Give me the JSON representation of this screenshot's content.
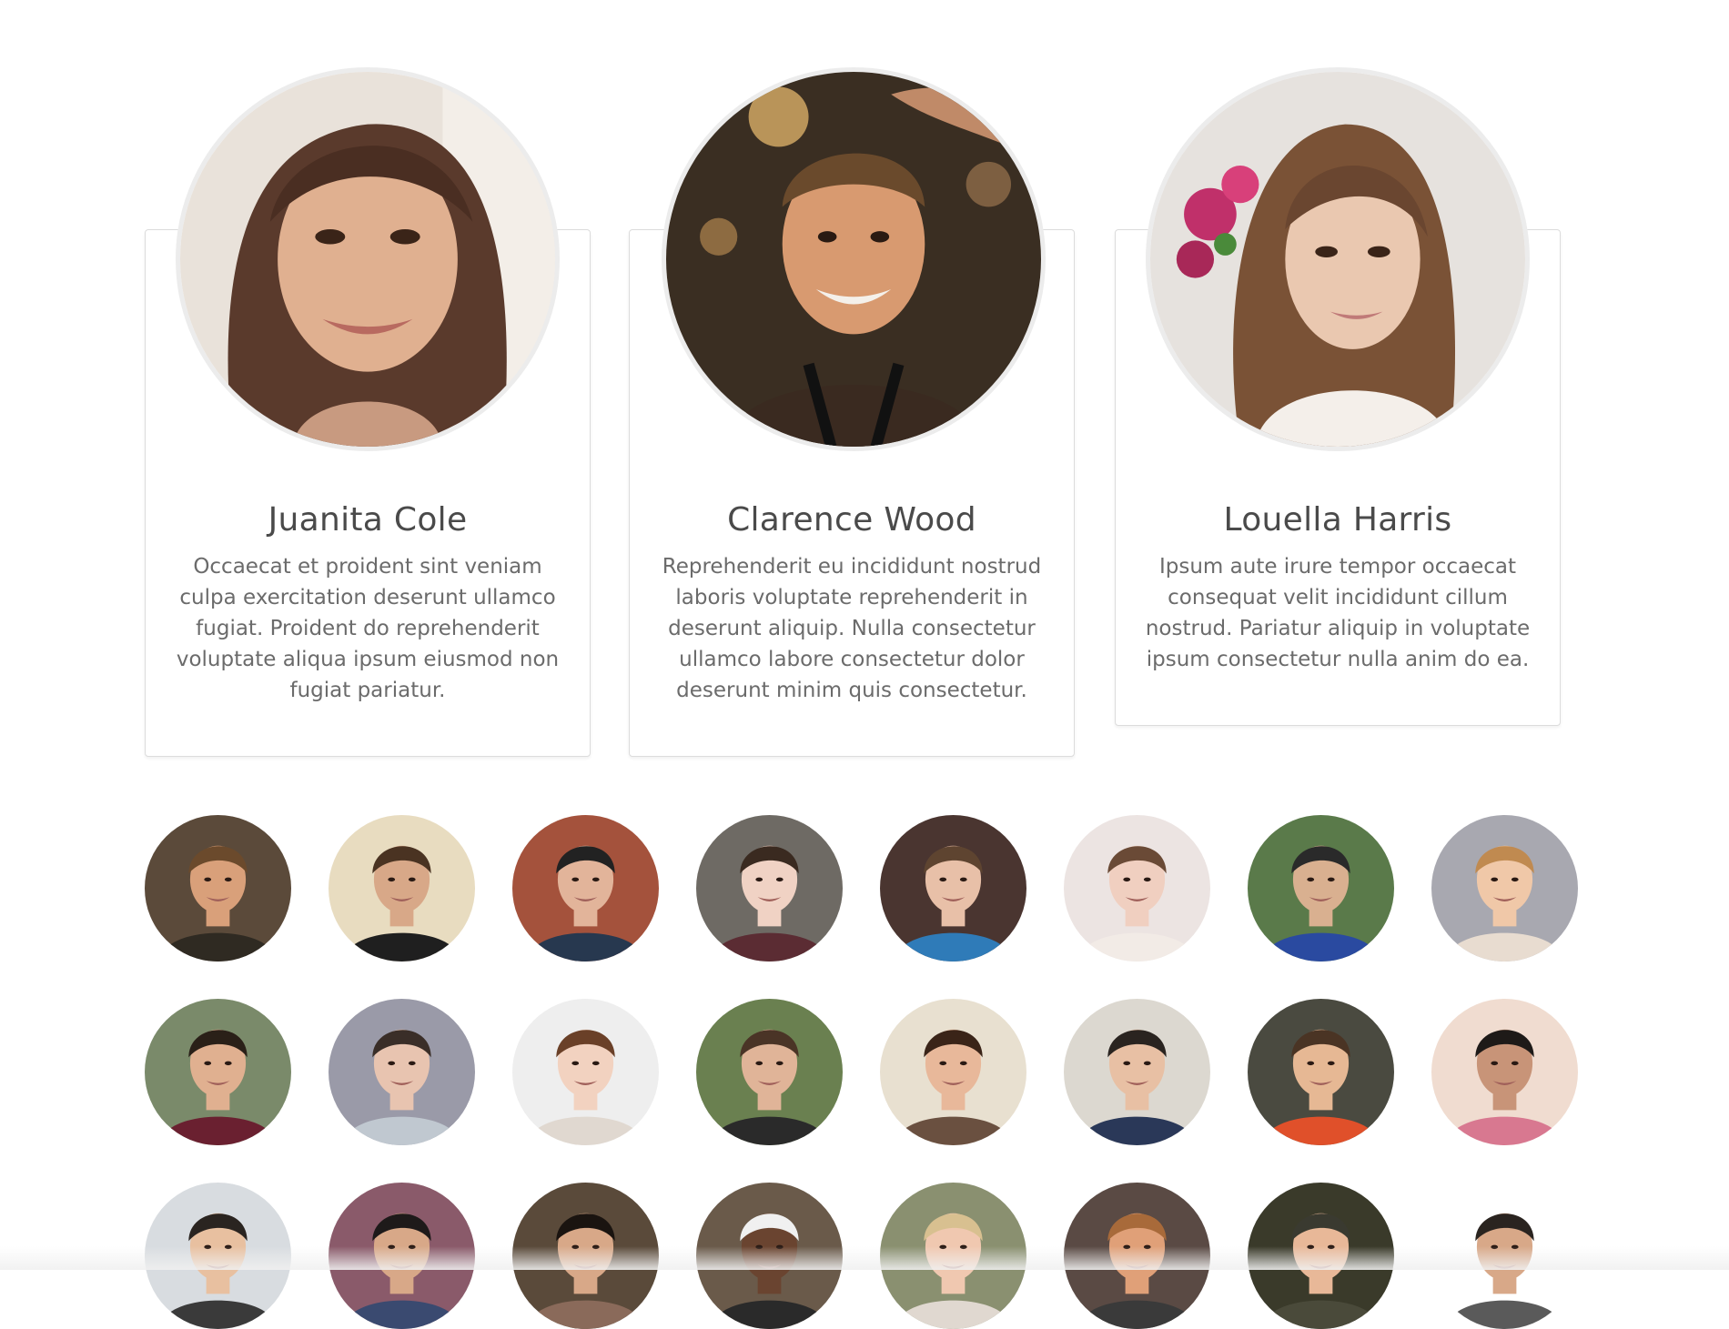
{
  "profiles": [
    {
      "name": "Juanita Cole",
      "description": "Occaecat et proident sint veniam culpa exercitation deserunt ullamco fugiat. Proident do reprehenderit voluptate aliqua ipsum eiusmod non fugiat pariatur.",
      "photo_icon": "woman-portrait-photo-icon"
    },
    {
      "name": "Clarence Wood",
      "description": "Reprehenderit eu incididunt nostrud laboris voluptate reprehenderit in deserunt aliquip. Nulla consectetur ullamco labore consectetur dolor deserunt minim quis consectetur.",
      "photo_icon": "man-portrait-photo-icon"
    },
    {
      "name": "Louella Harris",
      "description": "Ipsum aute irure tempor occaecat consequat velit incididunt cillum nostrud. Pariatur aliquip in voluptate ipsum consectetur nulla anim do ea.",
      "photo_icon": "woman-portrait-photo-icon"
    }
  ],
  "avatar_grid": {
    "columns": 8,
    "visible_rows": 3,
    "avatars": [
      {
        "bg": "#5b4a3a",
        "skin": "#d9a07a",
        "hair": "#6b4a2c",
        "shirt": "#2f2a22"
      },
      {
        "bg": "#e8dcc0",
        "skin": "#d8a888",
        "hair": "#4a3322",
        "shirt": "#1f1f1f"
      },
      {
        "bg": "#a4523c",
        "skin": "#e2b49a",
        "hair": "#222222",
        "shirt": "#27384f"
      },
      {
        "bg": "#6e6a64",
        "skin": "#f0d2c4",
        "hair": "#3a2a20",
        "shirt": "#5b2c33"
      },
      {
        "bg": "#4a3530",
        "skin": "#e8c0a8",
        "hair": "#5e4430",
        "shirt": "#2f7bb8"
      },
      {
        "bg": "#ece4e2",
        "skin": "#f0cfc0",
        "hair": "#6a4a36",
        "shirt": "#f2ebe6"
      },
      {
        "bg": "#5a7a4a",
        "skin": "#d9b090",
        "hair": "#2a2a2a",
        "shirt": "#2a4aa0"
      },
      {
        "bg": "#a8a8b0",
        "skin": "#f0c8a8",
        "hair": "#c08a50",
        "shirt": "#e8dcd0"
      },
      {
        "bg": "#7a8a6a",
        "skin": "#e0b090",
        "hair": "#2a2018",
        "shirt": "#6a2030"
      },
      {
        "bg": "#9a9aa8",
        "skin": "#e8c4b0",
        "hair": "#3a2e28",
        "shirt": "#c0c8d0"
      },
      {
        "bg": "#eeeeee",
        "skin": "#f2d2c0",
        "hair": "#6a4028",
        "shirt": "#e0d8d0"
      },
      {
        "bg": "#6a8050",
        "skin": "#e0b498",
        "hair": "#4a3426",
        "shirt": "#2a2a2a"
      },
      {
        "bg": "#e8e0d0",
        "skin": "#e8b89a",
        "hair": "#3a2418",
        "shirt": "#6a5040"
      },
      {
        "bg": "#dcd8d0",
        "skin": "#e8c0a4",
        "hair": "#2a2420",
        "shirt": "#2a3858"
      },
      {
        "bg": "#4a4a40",
        "skin": "#e6b894",
        "hair": "#4a3424",
        "shirt": "#e0502a"
      },
      {
        "bg": "#f0dcd0",
        "skin": "#c89478",
        "hair": "#1e1a18",
        "shirt": "#d87890"
      },
      {
        "bg": "#d8dce0",
        "skin": "#e8c0a0",
        "hair": "#2a2420",
        "shirt": "#3a3a3a"
      },
      {
        "bg": "#8a5a6a",
        "skin": "#d8a888",
        "hair": "#1e1a1a",
        "shirt": "#3a4a70"
      },
      {
        "bg": "#5a4a3a",
        "skin": "#d8a888",
        "hair": "#1a1410",
        "shirt": "#8a6a5a"
      },
      {
        "bg": "#6a5a4a",
        "skin": "#6a4430",
        "hair": "#f0f0f0",
        "shirt": "#2a2a2a"
      },
      {
        "bg": "#8a9070",
        "skin": "#f0c8b0",
        "hair": "#d8c090",
        "shirt": "#e0d8d0"
      },
      {
        "bg": "#5a4a44",
        "skin": "#e0a078",
        "hair": "#a86a3a",
        "shirt": "#3a3a3a"
      },
      {
        "bg": "#3a3a2a",
        "skin": "#e8b898",
        "hair": "#3a3a30",
        "shirt": "#4a4a3a"
      },
      {
        "bg": "#ffffff",
        "skin": "#d8a888",
        "hair": "#2a2420",
        "shirt": "#5a5a5a"
      }
    ]
  }
}
